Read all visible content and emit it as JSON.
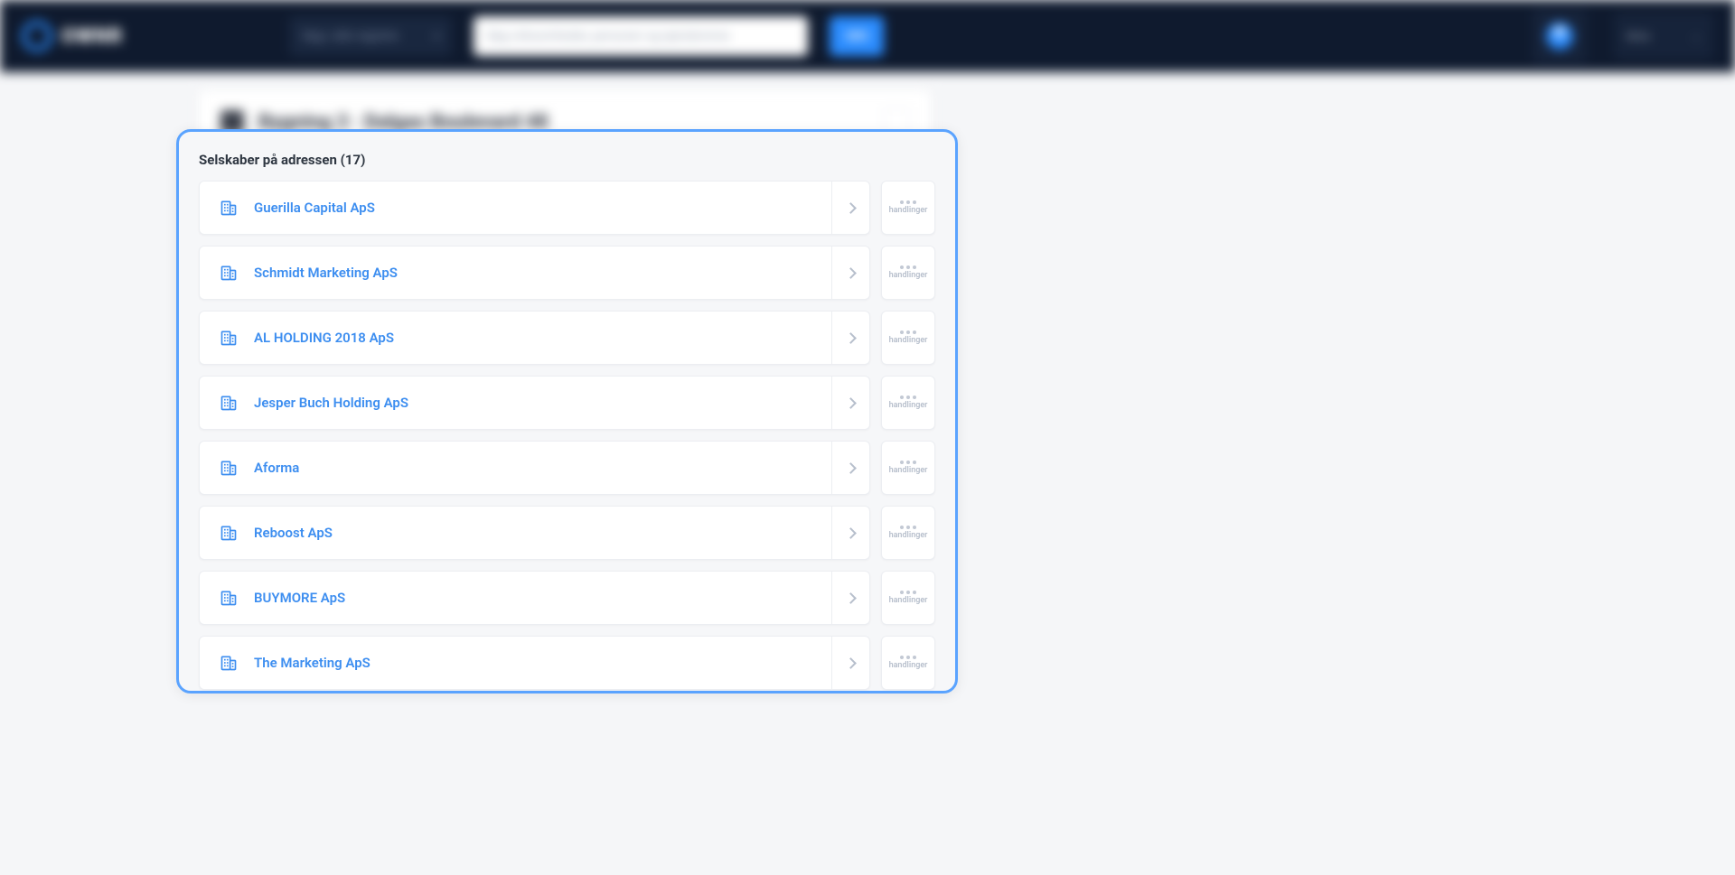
{
  "topbar": {
    "logo_text": "OWNR",
    "region_label": "Søg i alle registre",
    "search_placeholder": "Søg virksomheder, personer og ejendomme",
    "search_button": "SØG",
    "user_label": "Mine"
  },
  "page": {
    "breadcrumb_title": "Bygning 3 · Dalgas Boulevard 48"
  },
  "panel": {
    "title_prefix": "Selskaber på adressen",
    "count": 17,
    "actions_label": "handlinger",
    "companies": [
      {
        "name": "Guerilla Capital ApS"
      },
      {
        "name": "Schmidt Marketing ApS"
      },
      {
        "name": "AL HOLDING 2018 ApS"
      },
      {
        "name": "Jesper Buch Holding ApS"
      },
      {
        "name": "Aforma"
      },
      {
        "name": "Reboost ApS"
      },
      {
        "name": "BUYMORE ApS"
      },
      {
        "name": "The Marketing ApS"
      }
    ]
  }
}
